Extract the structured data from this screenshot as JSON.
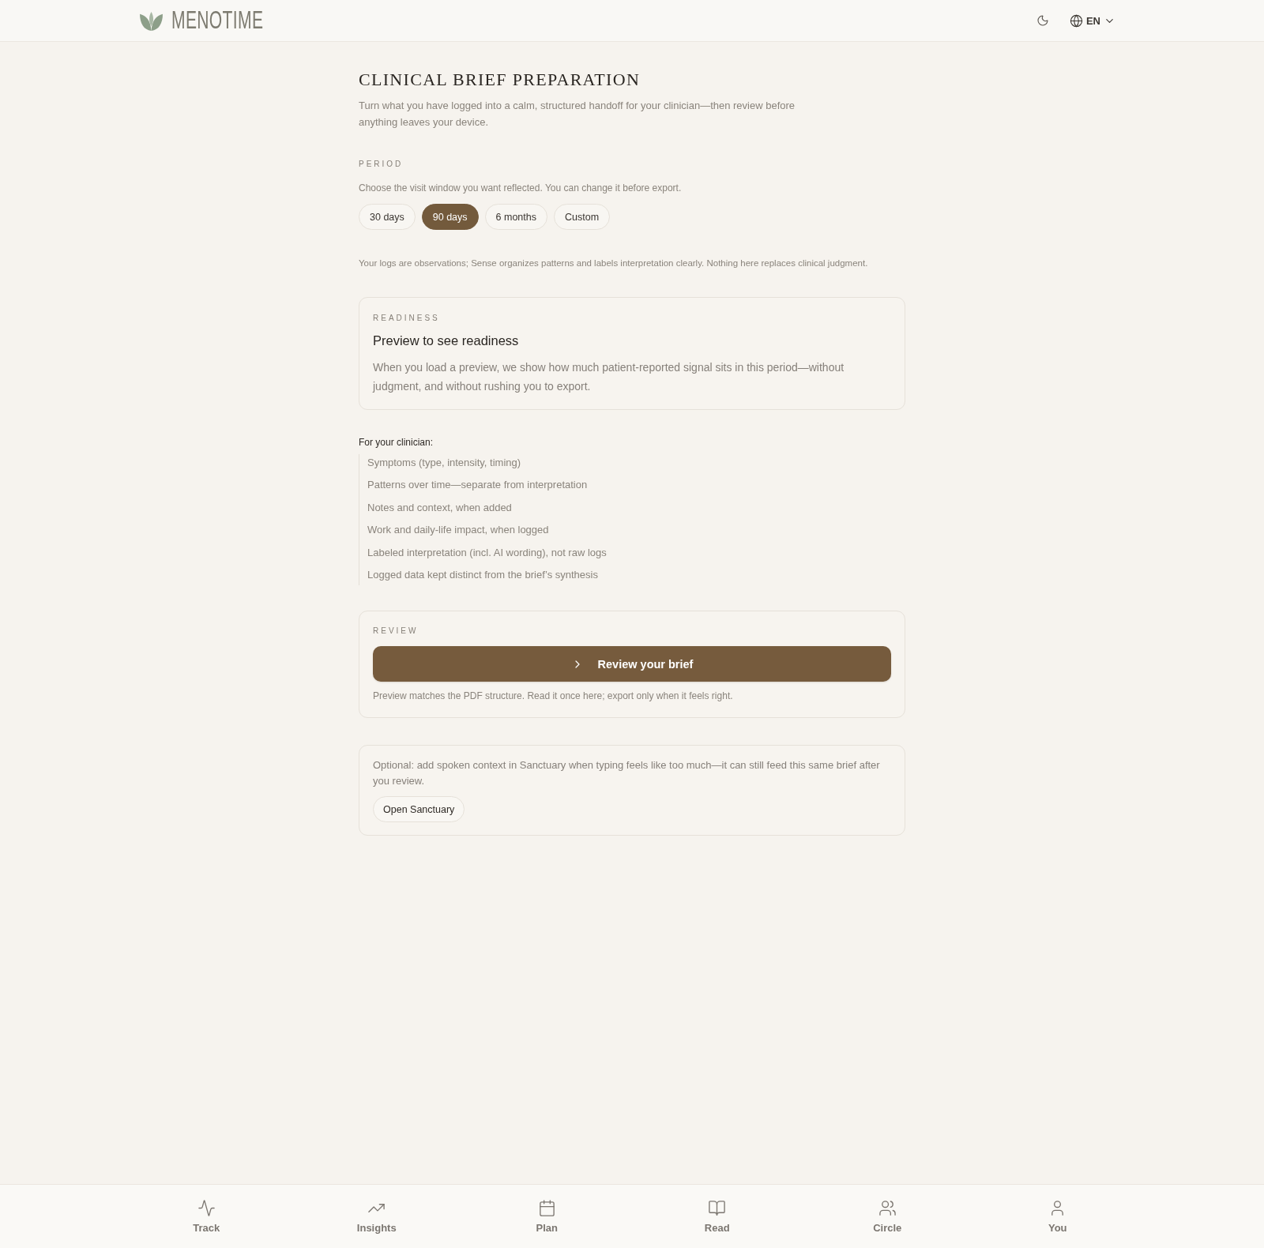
{
  "header": {
    "logo_text": "MENOTIME",
    "language": "EN"
  },
  "page": {
    "title": "CLINICAL BRIEF PREPARATION",
    "subtitle": "Turn what you have logged into a calm, structured handoff for your clinician—then review before anything leaves your device."
  },
  "period": {
    "label": "PERIOD",
    "help": "Choose the visit window you want reflected. You can change it before export.",
    "options": [
      {
        "label": "30 days",
        "selected": false
      },
      {
        "label": "90 days",
        "selected": true
      },
      {
        "label": "6 months",
        "selected": false
      },
      {
        "label": "Custom",
        "selected": false
      }
    ]
  },
  "disclaimer": "Your logs are observations; Sense organizes patterns and labels interpretation clearly. Nothing here replaces clinical judgment.",
  "readiness_card": {
    "label": "READINESS",
    "title": "Preview to see readiness",
    "body": "When you load a preview, we show how much patient-reported signal sits in this period—without judgment, and without rushing you to export."
  },
  "clinician_list": {
    "heading": "For your clinician:",
    "items": [
      "Symptoms (type, intensity, timing)",
      "Patterns over time—separate from interpretation",
      "Notes and context, when added",
      "Work and daily-life impact, when logged",
      "Labeled interpretation (incl. AI wording), not raw logs",
      "Logged data kept distinct from the brief’s synthesis"
    ]
  },
  "review_card": {
    "label": "REVIEW",
    "button": "Review your brief",
    "note": "Preview matches the PDF structure. Read it once here; export only when it feels right."
  },
  "sanctuary_card": {
    "text": "Optional: add spoken context in Sanctuary when typing feels like too much—it can still feed this same brief after you review.",
    "button": "Open Sanctuary"
  },
  "bottom_nav": [
    {
      "label": "Track",
      "selected": false
    },
    {
      "label": "Insights",
      "selected": false
    },
    {
      "label": "Plan",
      "selected": false
    },
    {
      "label": "Read",
      "selected": false
    },
    {
      "label": "Circle",
      "selected": false
    },
    {
      "label": "You",
      "selected": false
    }
  ]
}
